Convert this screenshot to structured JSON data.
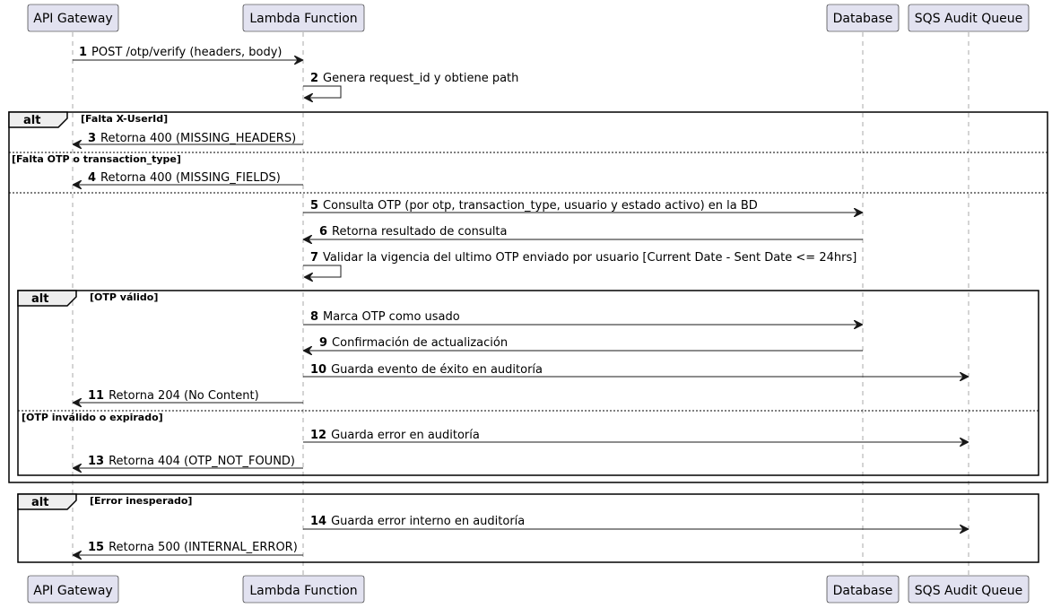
{
  "participants": [
    {
      "id": "api",
      "label": "API Gateway"
    },
    {
      "id": "lambda",
      "label": "Lambda Function"
    },
    {
      "id": "db",
      "label": "Database"
    },
    {
      "id": "sqs",
      "label": "SQS Audit Queue"
    }
  ],
  "messages": [
    {
      "num": "1",
      "label": "POST /otp/verify (headers, body)",
      "from": "api",
      "to": "lambda"
    },
    {
      "num": "2",
      "label": "Genera request_id y obtiene path",
      "from": "lambda",
      "to": "lambda"
    },
    {
      "num": "3",
      "label": "Retorna 400 (MISSING_HEADERS)",
      "from": "lambda",
      "to": "api"
    },
    {
      "num": "4",
      "label": "Retorna 400 (MISSING_FIELDS)",
      "from": "lambda",
      "to": "api"
    },
    {
      "num": "5",
      "label": "Consulta OTP (por otp, transaction_type, usuario y estado activo) en la BD",
      "from": "lambda",
      "to": "db"
    },
    {
      "num": "6",
      "label": "Retorna resultado de consulta",
      "from": "db",
      "to": "lambda"
    },
    {
      "num": "7",
      "label": "Validar la vigencia del ultimo OTP enviado por usuario [Current Date - Sent Date <= 24hrs]",
      "from": "lambda",
      "to": "lambda"
    },
    {
      "num": "8",
      "label": "Marca OTP como usado",
      "from": "lambda",
      "to": "db"
    },
    {
      "num": "9",
      "label": "Confirmación de actualización",
      "from": "db",
      "to": "lambda"
    },
    {
      "num": "10",
      "label": "Guarda evento de éxito en auditoría",
      "from": "lambda",
      "to": "sqs"
    },
    {
      "num": "11",
      "label": "Retorna 204 (No Content)",
      "from": "lambda",
      "to": "api"
    },
    {
      "num": "12",
      "label": "Guarda error en auditoría",
      "from": "lambda",
      "to": "sqs"
    },
    {
      "num": "13",
      "label": "Retorna 404 (OTP_NOT_FOUND)",
      "from": "lambda",
      "to": "api"
    },
    {
      "num": "14",
      "label": "Guarda error interno en auditoría",
      "from": "lambda",
      "to": "sqs"
    },
    {
      "num": "15",
      "label": "Retorna 500 (INTERNAL_ERROR)",
      "from": "lambda",
      "to": "api"
    }
  ],
  "fragments": [
    {
      "keyword": "alt",
      "guard": "[Falta X-UserId]",
      "else_guards": [
        "[Falta OTP o transaction_type]",
        ""
      ]
    },
    {
      "keyword": "alt",
      "guard": "[OTP válido]",
      "else_guards": [
        "[OTP inválido o expirado]"
      ]
    },
    {
      "keyword": "alt",
      "guard": "[Error inesperado]",
      "else_guards": []
    }
  ]
}
